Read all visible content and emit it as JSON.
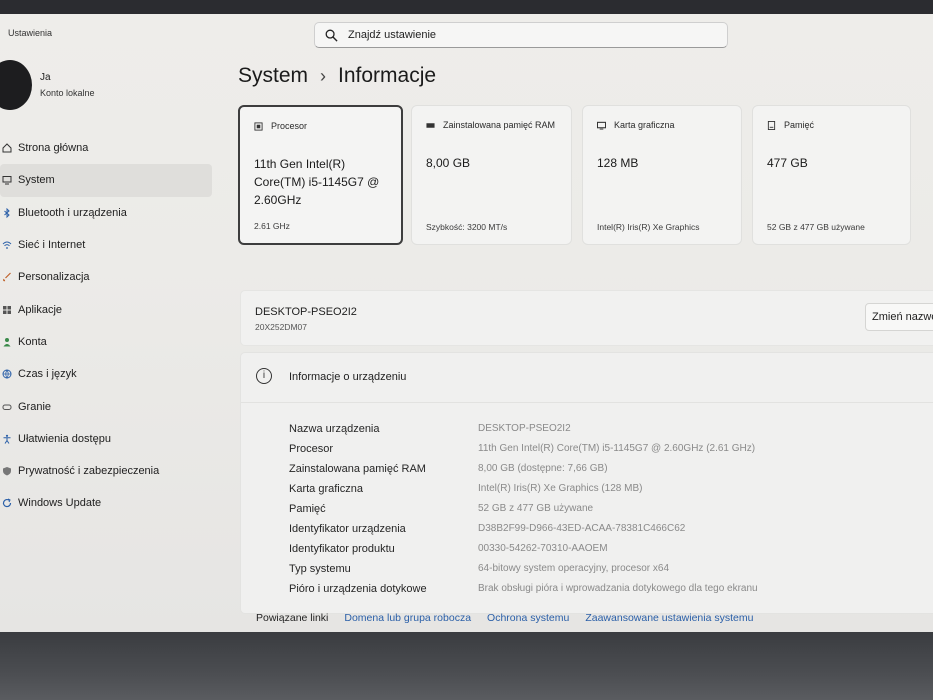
{
  "window": {
    "title": "Ustawienia"
  },
  "search": {
    "placeholder": "Znajdź ustawienie"
  },
  "user": {
    "name": "Ja",
    "account": "Konto lokalne"
  },
  "sidebar": {
    "items": [
      {
        "label": "Strona główna",
        "icon": "home-icon"
      },
      {
        "label": "System",
        "icon": "monitor-icon",
        "active": true
      },
      {
        "label": "Bluetooth i urządzenia",
        "icon": "bluetooth-icon"
      },
      {
        "label": "Sieć i Internet",
        "icon": "wifi-icon"
      },
      {
        "label": "Personalizacja",
        "icon": "brush-icon"
      },
      {
        "label": "Aplikacje",
        "icon": "apps-icon"
      },
      {
        "label": "Konta",
        "icon": "person-icon"
      },
      {
        "label": "Czas i język",
        "icon": "globe-icon"
      },
      {
        "label": "Granie",
        "icon": "gamepad-icon"
      },
      {
        "label": "Ułatwienia dostępu",
        "icon": "accessibility-icon"
      },
      {
        "label": "Prywatność i zabezpieczenia",
        "icon": "shield-icon"
      },
      {
        "label": "Windows Update",
        "icon": "update-icon"
      }
    ]
  },
  "header": {
    "breadcrumb_parent": "System",
    "separator": "›",
    "title": "Informacje"
  },
  "cards": [
    {
      "label": "Procesor",
      "value": "11th Gen Intel(R) Core(TM) i5-1145G7 @ 2.60GHz",
      "sub": "2.61 GHz",
      "icon": "cpu-icon"
    },
    {
      "label": "Zainstalowana pamięć RAM",
      "value": "8,00 GB",
      "sub": "Szybkość: 3200 MT/s",
      "icon": "ram-icon"
    },
    {
      "label": "Karta graficzna",
      "value": "128 MB",
      "sub": "Intel(R) Iris(R) Xe Graphics",
      "icon": "gpu-icon"
    },
    {
      "label": "Pamięć",
      "value": "477 GB",
      "sub": "52 GB z 477 GB używane",
      "icon": "storage-icon"
    }
  ],
  "device": {
    "name": "DESKTOP-PSEO2I2",
    "model": "20X252DM07",
    "rename_label": "Zmień nazwę"
  },
  "specs": {
    "title": "Informacje o urządzeniu",
    "rows": [
      {
        "key": "Nazwa urządzenia",
        "value": "DESKTOP-PSEO2I2"
      },
      {
        "key": "Procesor",
        "value": "11th Gen Intel(R) Core(TM) i5-1145G7 @ 2.60GHz (2.61 GHz)"
      },
      {
        "key": "Zainstalowana pamięć RAM",
        "value": "8,00 GB (dostępne: 7,66 GB)"
      },
      {
        "key": "Karta graficzna",
        "value": "Intel(R) Iris(R) Xe Graphics (128 MB)"
      },
      {
        "key": "Pamięć",
        "value": "52 GB z 477 GB używane"
      },
      {
        "key": "Identyfikator urządzenia",
        "value": "D38B2F99-D966-43ED-ACAA-78381C466C62"
      },
      {
        "key": "Identyfikator produktu",
        "value": "00330-54262-70310-AAOEM"
      },
      {
        "key": "Typ systemu",
        "value": "64-bitowy system operacyjny, procesor x64"
      },
      {
        "key": "Pióro i urządzenia dotykowe",
        "value": "Brak obsługi pióra i wprowadzania dotykowego dla tego ekranu"
      }
    ]
  },
  "related": {
    "title": "Powiązane linki",
    "links": [
      "Domena lub grupa robocza",
      "Ochrona systemu",
      "Zaawansowane ustawienia systemu"
    ]
  },
  "colors": {
    "accent": "#2a5fa8",
    "background": "#eeedea",
    "selected_border": "#3d3d3d"
  }
}
